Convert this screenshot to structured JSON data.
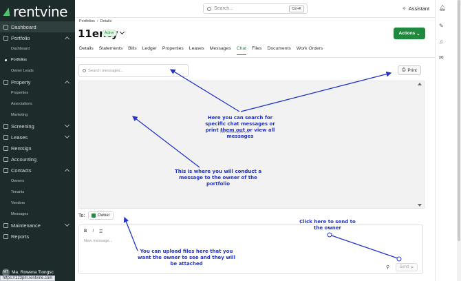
{
  "app": {
    "logo_text": "rentvine"
  },
  "sidebar": {
    "items": [
      {
        "label": "Dashboard",
        "icon": "grid-icon"
      },
      {
        "label": "Portfolio",
        "icon": "folder-icon"
      },
      {
        "label": "Dashboard",
        "sub": true
      },
      {
        "label": "Portfolios",
        "sub": true,
        "active": true
      },
      {
        "label": "Owner Leads",
        "sub": true
      },
      {
        "label": "Property",
        "icon": "building-icon"
      },
      {
        "label": "Properties",
        "sub": true
      },
      {
        "label": "Associations",
        "sub": true
      },
      {
        "label": "Marketing",
        "sub": true
      },
      {
        "label": "Screening",
        "icon": "filter-icon"
      },
      {
        "label": "Leases",
        "icon": "document-icon"
      },
      {
        "label": "Rentsign",
        "icon": "pen-icon"
      },
      {
        "label": "Accounting",
        "icon": "bank-icon"
      },
      {
        "label": "Contacts",
        "icon": "contacts-icon"
      },
      {
        "label": "Owners",
        "sub": true
      },
      {
        "label": "Tenants",
        "sub": true
      },
      {
        "label": "Vendors",
        "sub": true
      },
      {
        "label": "Messages",
        "sub": true
      },
      {
        "label": "Maintenance",
        "icon": "wrench-icon"
      },
      {
        "label": "Reports",
        "icon": "chart-icon"
      }
    ],
    "user": {
      "initials": "MT",
      "name": "Ma. Rowena Tiongsc"
    },
    "status_url": "https://123pm.rentvine.com"
  },
  "topbar": {
    "search_placeholder": "Search...",
    "shortcut": "Ctrl+K",
    "assistant_label": "Assistant"
  },
  "page": {
    "breadcrumb": [
      "Portfolios",
      "Details"
    ],
    "title": "11enty",
    "status_badge": "Active",
    "actions_label": "Actions",
    "tabs": [
      "Details",
      "Statements",
      "Bills",
      "Ledger",
      "Properties",
      "Leases",
      "Messages",
      "Chat",
      "Files",
      "Documents",
      "Work Orders"
    ],
    "active_tab": "Chat"
  },
  "chat": {
    "search_placeholder": "Search messages...",
    "print_label": "Print",
    "empty_text": "No messages yet",
    "to_label": "To:",
    "recipient": "Owner",
    "composer_placeholder": "New message...",
    "format_buttons": [
      "B",
      "I",
      "☰"
    ],
    "send_label": "Send"
  },
  "annotations": {
    "search_print": "Here you can search for specific chat messages or print them out or view all messages",
    "conduct": "This is where you will conduct a message to the owner of the portfolio",
    "send": "Click here to send to the owner",
    "upload": "You can upload files here that you want the owner to see and they will be attached"
  },
  "colors": {
    "sidebar_bg": "#1d2b2a",
    "brand_green": "#1f8a3e",
    "annotation_blue": "#2233c9"
  }
}
